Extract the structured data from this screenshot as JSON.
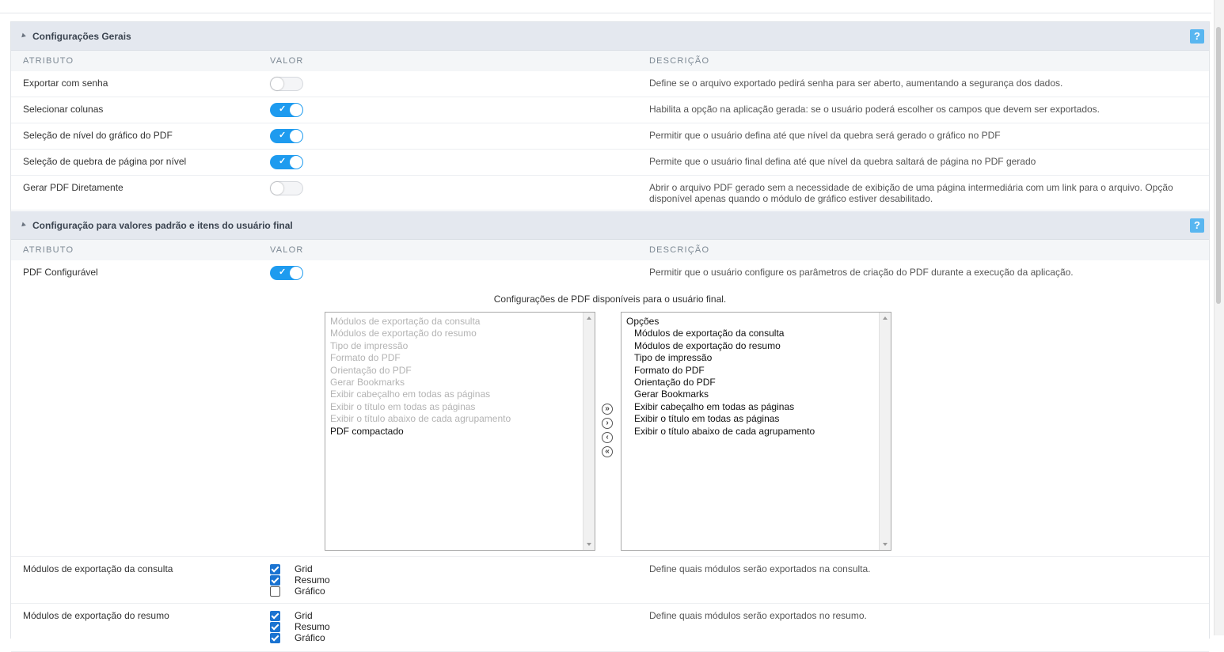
{
  "section1": {
    "title": "Configurações Gerais",
    "help": "?",
    "columns": {
      "attr": "ATRIBUTO",
      "value": "VALOR",
      "desc": "DESCRIÇÃO"
    },
    "rows": [
      {
        "attr": "Exportar com senha",
        "on": false,
        "desc": "Define se o arquivo exportado pedirá senha para ser aberto, aumentando a segurança dos dados."
      },
      {
        "attr": "Selecionar colunas",
        "on": true,
        "desc": "Habilita a opção na aplicação gerada: se o usuário poderá escolher os campos que devem ser exportados."
      },
      {
        "attr": "Seleção de nível do gráfico do PDF",
        "on": true,
        "desc": "Permitir que o usuário defina até que nível da quebra será gerado o gráfico no PDF"
      },
      {
        "attr": "Seleção de quebra de página por nível",
        "on": true,
        "desc": "Permite que o usuário final defina até que nível da quebra saltará de página no PDF gerado"
      },
      {
        "attr": "Gerar PDF Diretamente",
        "on": false,
        "desc": "Abrir o arquivo PDF gerado sem a necessidade de exibição de uma página intermediária com um link para o arquivo. Opção disponível apenas quando o módulo de gráfico estiver desabilitado."
      }
    ]
  },
  "section2": {
    "title": "Configuração para valores padrão e itens do usuário final",
    "help": "?",
    "columns": {
      "attr": "ATRIBUTO",
      "value": "VALOR",
      "desc": "DESCRIÇÃO"
    },
    "pdf_row": {
      "attr": "PDF Configurável",
      "on": true,
      "desc": "Permitir que o usuário configure os parâmetros de criação do PDF durante a execução da aplicação."
    },
    "lists_caption": "Configurações de PDF disponíveis para o usuário final.",
    "left_list": [
      {
        "label": "Módulos de exportação da consulta",
        "enabled": false
      },
      {
        "label": "Módulos de exportação do resumo",
        "enabled": false
      },
      {
        "label": "Tipo de impressão",
        "enabled": false
      },
      {
        "label": "Formato do PDF",
        "enabled": false
      },
      {
        "label": "Orientação do PDF",
        "enabled": false
      },
      {
        "label": "Gerar Bookmarks",
        "enabled": false
      },
      {
        "label": "Exibir cabeçalho em todas as páginas",
        "enabled": false
      },
      {
        "label": "Exibir o título em todas as páginas",
        "enabled": false
      },
      {
        "label": "Exibir o título abaixo de cada agrupamento",
        "enabled": false
      },
      {
        "label": "PDF compactado",
        "enabled": true
      }
    ],
    "right_list_header": "Opções",
    "right_list": [
      "Módulos de exportação da consulta",
      "Módulos de exportação do resumo",
      "Tipo de impressão",
      "Formato do PDF",
      "Orientação do PDF",
      "Gerar Bookmarks",
      "Exibir cabeçalho em todas as páginas",
      "Exibir o título em todas as páginas",
      "Exibir o título abaixo de cada agrupamento"
    ],
    "move_buttons": [
      "»",
      "›",
      "‹",
      "«"
    ],
    "checkbox_rows": [
      {
        "attr": "Módulos de exportação da consulta",
        "desc": "Define quais módulos serão exportados na consulta.",
        "options": [
          {
            "label": "Grid",
            "checked": true
          },
          {
            "label": "Resumo",
            "checked": true
          },
          {
            "label": "Gráfico",
            "checked": false
          }
        ]
      },
      {
        "attr": "Módulos de exportação do resumo",
        "desc": "Define quais módulos serão exportados no resumo.",
        "options": [
          {
            "label": "Grid",
            "checked": true
          },
          {
            "label": "Resumo",
            "checked": true
          },
          {
            "label": "Gráfico",
            "checked": true
          }
        ]
      }
    ]
  }
}
